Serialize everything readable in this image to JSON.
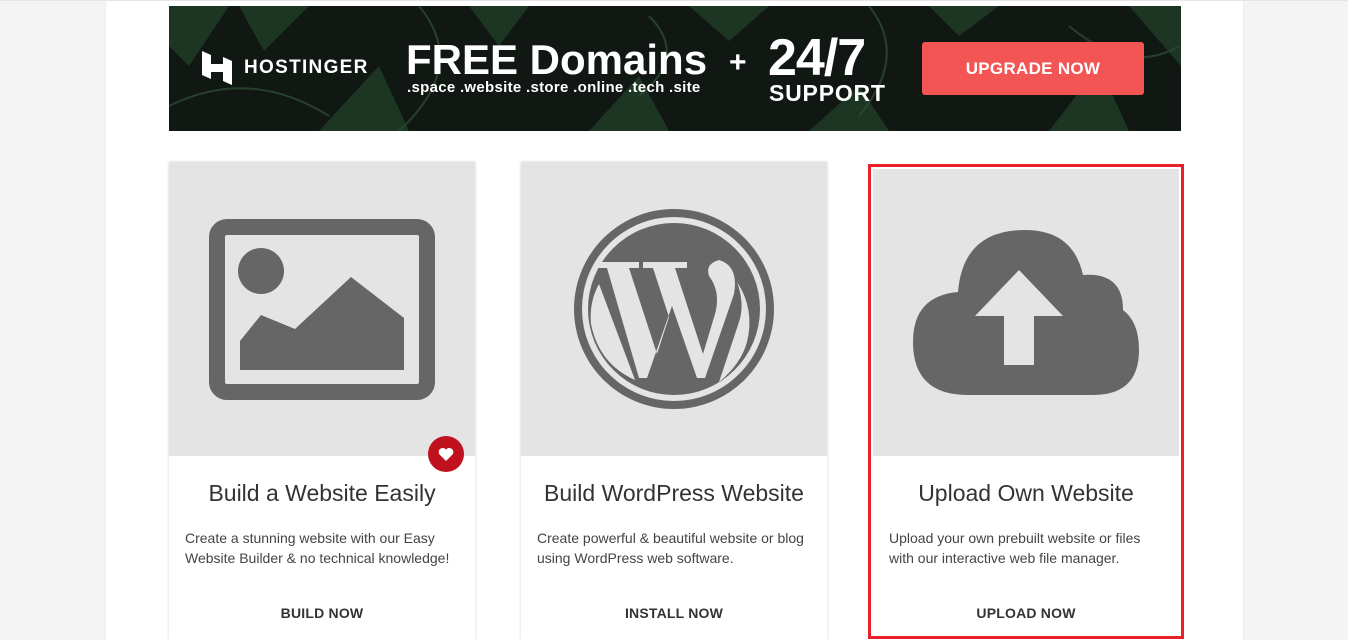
{
  "banner": {
    "brand": "HOSTINGER",
    "headline": "FREE Domains",
    "tlds": ".space .website .store .online .tech .site",
    "plus": "+",
    "support_big": "24/7",
    "support_word": "SUPPORT",
    "cta": "UPGRADE NOW"
  },
  "cards": [
    {
      "title": "Build a Website Easily",
      "desc": "Create a stunning website with our Easy Website Builder & no technical knowledge!",
      "action": "BUILD NOW",
      "icon": "image-icon",
      "favorite": true
    },
    {
      "title": "Build WordPress Website",
      "desc": "Create powerful & beautiful website or blog using WordPress web software.",
      "action": "INSTALL NOW",
      "icon": "wordpress-icon"
    },
    {
      "title": "Upload Own Website",
      "desc": "Upload your own prebuilt website or files with our interactive web file manager.",
      "action": "UPLOAD NOW",
      "icon": "cloud-upload-icon",
      "highlighted": true
    }
  ],
  "colors": {
    "accent": "#f35454",
    "favorite": "#c0111f",
    "highlight": "#e8202a",
    "icon_gray": "#666666"
  }
}
